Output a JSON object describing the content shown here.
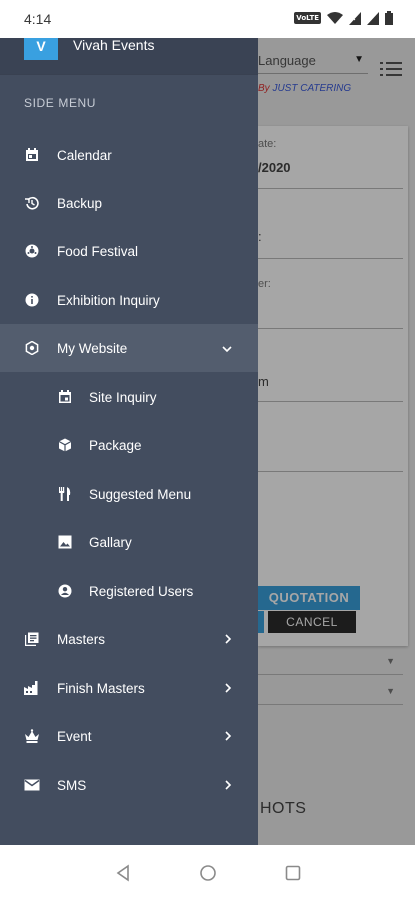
{
  "status_bar": {
    "time": "4:14",
    "volte": "VoLTE"
  },
  "background": {
    "language_select": "Language",
    "by_prefix": "By ",
    "by_name": "JUST CATERING",
    "fields": [
      "ate:",
      "/2020",
      ":",
      "er:",
      "m"
    ],
    "quotation_button": "QUOTATION",
    "cancel_button": "CANCEL",
    "snapshots": "HOTS"
  },
  "drawer": {
    "logo_letter": "V",
    "app_name": "Vivah Events",
    "section_title": "SIDE MENU",
    "items": [
      {
        "label": "Calendar",
        "icon": "calendar-icon"
      },
      {
        "label": "Backup",
        "icon": "restore-icon"
      },
      {
        "label": "Food Festival",
        "icon": "food-icon"
      },
      {
        "label": "Exhibition Inquiry",
        "icon": "info-icon"
      },
      {
        "label": "My Website",
        "icon": "hexagon-gear-icon",
        "expanded": true
      },
      {
        "label": "Site Inquiry",
        "icon": "event-icon"
      },
      {
        "label": "Package",
        "icon": "cube-icon"
      },
      {
        "label": "Suggested Menu",
        "icon": "restaurant-icon"
      },
      {
        "label": "Gallary",
        "icon": "image-icon"
      },
      {
        "label": "Registered Users",
        "icon": "account-icon"
      },
      {
        "label": "Masters",
        "icon": "library-icon"
      },
      {
        "label": "Finish Masters",
        "icon": "factory-icon"
      },
      {
        "label": "Event",
        "icon": "crown-icon"
      },
      {
        "label": "SMS",
        "icon": "mail-icon"
      }
    ]
  },
  "colors": {
    "drawer_bg": "#434d5f",
    "active_bg": "#535d6e",
    "accent": "#39a0e0"
  }
}
